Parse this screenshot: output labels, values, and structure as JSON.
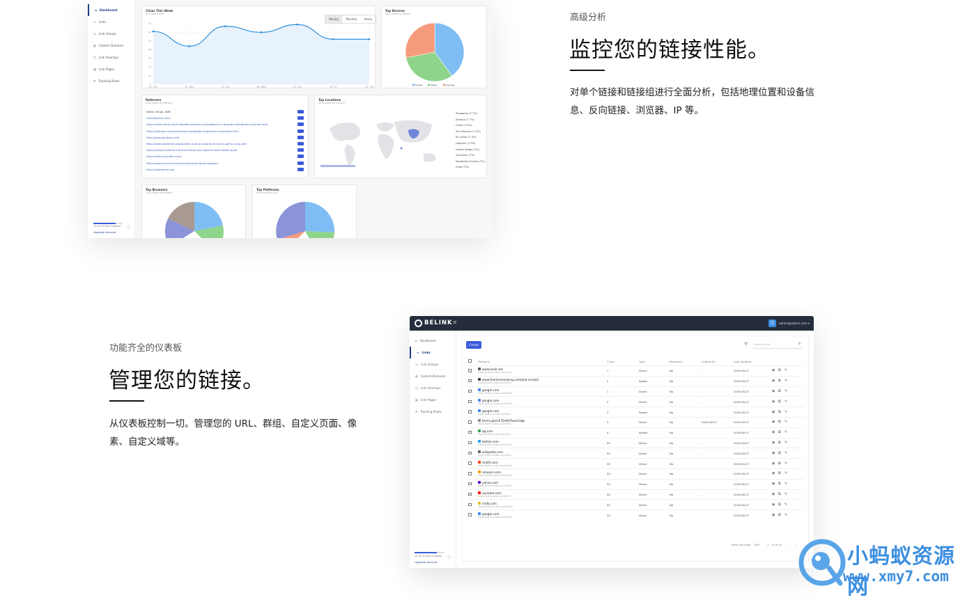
{
  "section1": {
    "eyebrow": "高级分析",
    "heading": "监控您的链接性能。",
    "description": "对单个链接和链接组进行全面分析，包括地理位置和设备信息、反向链接、浏览器、IP 等。"
  },
  "section2": {
    "eyebrow": "功能齐全的仪表板",
    "heading": "管理您的链接。",
    "description": "从仪表板控制一切。管理您的 URL、群组、自定义页面、像素、自定义域等。"
  },
  "sidebar": {
    "items": [
      "Dashboard",
      "Links",
      "Link Groups",
      "Custom Domains",
      "Link Overlays",
      "Link Pages",
      "Tracking Pixels"
    ],
    "usage": "15 of 20 links created",
    "upgrade": "Upgrade Account"
  },
  "analytics": {
    "clicks_title": "Clicks This Week",
    "clicks_sub": "312 Total Clicks",
    "periods": [
      "Weekly",
      "Monthly",
      "Yearly"
    ],
    "active_period": "Weekly",
    "devices_title": "Top Devices",
    "devices_sub": "Click count by device",
    "device_legend": [
      "Mobile",
      "Tablet",
      "Desktop"
    ],
    "referrers_title": "Referrers",
    "referrers_sub": "Click count by referrer",
    "referrers": [
      "Direct, Email, SMS",
      "http://loshan.com/",
      "https://wind.com/a.dunt.kiepelka-possimus-voluptatum-in-aperiam-temporibus-earned.html",
      "https://johnson.com/ratione/hic/cupiditate-laudantium-molestiae.html",
      "http://www.jacobson.net/",
      "http://www.sanderwrt.org/quidem-sunt-accusantium-omnis-porro-iusuo-wte",
      "https://www.huckhkes.com/minime/omnis-sapiens-amet-debits-quae",
      "http://www.romyobm.com/",
      "http://www.ferry.com/iure/ratio/locam/in/dumcat/place",
      "http://www.berdt.org/"
    ],
    "locations_title": "Top Locations",
    "locations_sub": "Click count by country",
    "locations": [
      "Singapore (7.7%)",
      "Zambia (7.7%)",
      "China (7.4%)",
      "Sint Maarten (7.4%)",
      "Sri Lanka (7.3%)",
      "Lebanon (7.3%)",
      "United States (7%)",
      "Suriname (7%)",
      "Equatorial Guinea (7%)",
      "Chad (7%)"
    ],
    "browsers_title": "Top Browsers",
    "browsers_sub": "Click count by browser",
    "platforms_title": "Top Platforms",
    "platforms_sub": "Click count by OS"
  },
  "chart_data": [
    {
      "type": "line",
      "title": "Clicks This Week",
      "x": [
        "21, Thu",
        "24, Mon",
        "27, Tue",
        "28, Wed",
        "29, Thu",
        "30, Fri",
        "31, Sat"
      ],
      "values": [
        61,
        44,
        67,
        60,
        69,
        52,
        52
      ],
      "ylim": [
        0,
        70
      ],
      "yticks": [
        0,
        10,
        20,
        30,
        40,
        50,
        60,
        70
      ],
      "grid": true
    },
    {
      "type": "pie",
      "title": "Top Devices",
      "categories": [
        "Mobile",
        "Tablet",
        "Desktop"
      ],
      "values": [
        40,
        32,
        28
      ],
      "colors": [
        "#7fbef5",
        "#8fd48b",
        "#f59b7c"
      ]
    }
  ],
  "links_app": {
    "brand": "BELINK",
    "user": "admin@admin.com",
    "create_label": "Create",
    "search_placeholder": "Search links",
    "columns": [
      "Domains",
      "Clicks",
      "Type",
      "Password",
      "Expires At",
      "Last Updated"
    ],
    "rows": [
      {
        "domain": "www.kuah.net",
        "short": "https://belink.xebb.com/2Vx2h",
        "clicks": "1",
        "type": "Direct",
        "pw": "No",
        "exp": "-",
        "upd": "2019-08-27"
      },
      {
        "domain": "www.themesmacking.com/php-scripts/",
        "short": "https://belink.xebb.com/Zen6j",
        "clicks": "2",
        "type": "Splash",
        "pw": "No",
        "exp": "-",
        "upd": "2019-08-27"
      },
      {
        "domain": "google.com",
        "short": "https://belink.xebb.com/ZnBtd",
        "clicks": "1",
        "type": "Direct",
        "pw": "No",
        "exp": "-",
        "upd": "2019-08-27"
      },
      {
        "domain": "google.com",
        "short": "https://belink.xebb.com/w4Yh8",
        "clicks": "0",
        "type": "Direct",
        "pw": "No",
        "exp": "-",
        "upd": "2019-08-27"
      },
      {
        "domain": "google.com",
        "short": "https://belink.xebb.com/knsuj",
        "clicks": "3",
        "type": "Splash",
        "pw": "No",
        "exp": "-",
        "upd": "2019-08-27"
      },
      {
        "domain": "forms.gle/vE7QdXhTwssCdqb",
        "short": "https://belink.xebb.com/4tt3H",
        "clicks": "3",
        "type": "Direct",
        "pw": "No",
        "exp": "2020-08-27",
        "upd": "2019-08-27"
      },
      {
        "domain": "qq.com",
        "short": "https://belink.xebb.com/Jdr4q",
        "clicks": "4",
        "type": "Splash",
        "pw": "No",
        "exp": "-",
        "upd": "2019-08-27"
      },
      {
        "domain": "twitter.com",
        "short": "https://belink.xebb.com/mjuZT",
        "clicks": "50",
        "type": "Direct",
        "pw": "No",
        "exp": "-",
        "upd": "2019-08-27"
      },
      {
        "domain": "wikipedia.com",
        "short": "https://belink.xebb.com/fyeh4",
        "clicks": "50",
        "type": "Direct",
        "pw": "No",
        "exp": "-",
        "upd": "2019-08-27"
      },
      {
        "domain": "reddit.com",
        "short": "https://belink.xebb.com/Qp0Sa",
        "clicks": "50",
        "type": "Direct",
        "pw": "No",
        "exp": "-",
        "upd": "2019-08-27"
      },
      {
        "domain": "amazon.com",
        "short": "https://belink.xebb.com/SWYgr",
        "clicks": "50",
        "type": "Direct",
        "pw": "No",
        "exp": "-",
        "upd": "2019-08-27"
      },
      {
        "domain": "yahoo.com",
        "short": "https://belink.xebb.com/KsBhJ",
        "clicks": "50",
        "type": "Direct",
        "pw": "No",
        "exp": "-",
        "upd": "2019-08-27"
      },
      {
        "domain": "youtube.com",
        "short": "https://belink.xebb.com/IBI33",
        "clicks": "50",
        "type": "Direct",
        "pw": "No",
        "exp": "-",
        "upd": "2019-08-27"
      },
      {
        "domain": "imdb.com",
        "short": "https://belink.xebb.com/TQp4N",
        "clicks": "50",
        "type": "Direct",
        "pw": "No",
        "exp": "-",
        "upd": "2019-08-27"
      },
      {
        "domain": "google.com",
        "short": "https://belink.xebb.com/dKwkg",
        "clicks": "34",
        "type": "Direct",
        "pw": "No",
        "exp": "-",
        "upd": "2019-08-27"
      }
    ],
    "per_page_label": "Items per page",
    "per_page": "15",
    "range": "1 - 15 of 15"
  },
  "watermark": {
    "cn": "小蚂蚁资源网",
    "url": "www.xmy7.com"
  }
}
